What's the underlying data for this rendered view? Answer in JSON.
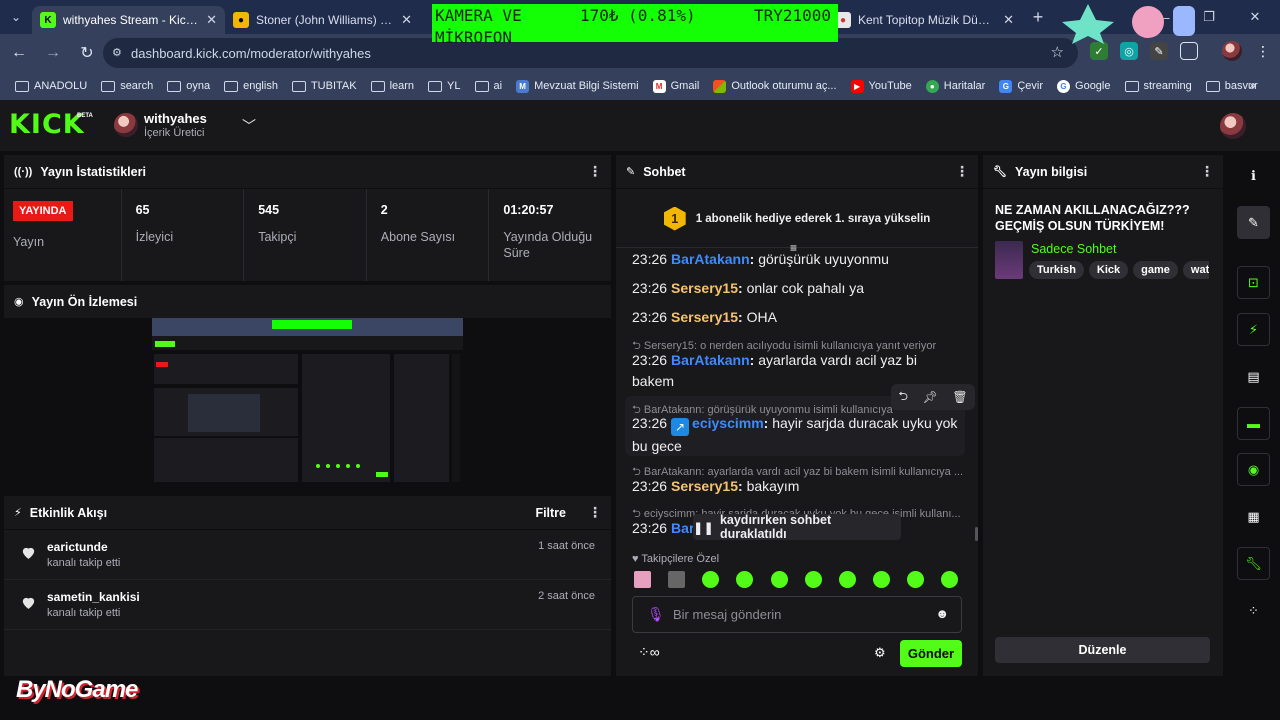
{
  "browser": {
    "tabs": [
      {
        "title": "withyahes Stream - Kick Dashboard",
        "favicon": "kick-icon"
      },
      {
        "title": "Stoner (John Williams) Fiyatı, Yorumları",
        "favicon": "coin-icon"
      },
      {
        "title": "Kent Topitop Müzik Düdüklü Maşa",
        "favicon": "site-icon"
      }
    ],
    "url": "dashboard.kick.com/moderator/withyahes",
    "bookmarks": [
      "ANADOLU",
      "search",
      "oyna",
      "english",
      "TUBITAK",
      "learn",
      "YL",
      "ai",
      "Mevzuat Bilgi Sistemi",
      "Gmail",
      "Outlook oturumu aç...",
      "YouTube",
      "Haritalar",
      "Çevir",
      "Google",
      "streaming",
      "basvur"
    ]
  },
  "overlay": {
    "line1": "KAMERA VE",
    "line2": "MİKROFON",
    "price": "170₺ (0.81%)",
    "total": "TRY21000"
  },
  "kick": {
    "logo": "KICK",
    "beta": "BETA",
    "channel_name": "withyahes",
    "channel_role": "İçerik Üretici"
  },
  "stats": {
    "title": "Yayın İstatistikleri",
    "live_badge": "YAYINDA",
    "live_label": "Yayın",
    "viewers_value": "65",
    "viewers_label": "İzleyici",
    "followers_value": "545",
    "followers_label": "Takipçi",
    "subs_value": "2",
    "subs_label": "Abone Sayısı",
    "uptime_value": "01:20:57",
    "uptime_label": "Yayında Olduğu Süre"
  },
  "preview": {
    "title": "Yayın Ön İzlemesi"
  },
  "activity": {
    "title": "Etkinlik Akışı",
    "filter": "Filtre",
    "items": [
      {
        "name": "earictunde",
        "action": "kanalı takip etti",
        "time": "1 saat önce"
      },
      {
        "name": "sametin_kankisi",
        "action": "kanalı takip etti",
        "time": "2 saat önce"
      }
    ]
  },
  "chat": {
    "title": "Sohbet",
    "sub_goal_rank": "1",
    "sub_goal_text": "1 abonelik hediye ederek 1. sıraya yükselin",
    "messages": [
      {
        "time": "23:26",
        "user": "BarAtakann",
        "text": "görüşürük uyuyonmu",
        "color": "#3d8bfd"
      },
      {
        "time": "23:26",
        "user": "Sersery15",
        "text": "onlar cok pahalı ya",
        "color": "#f5c36b"
      },
      {
        "time": "23:26",
        "user": "Sersery15",
        "text": "OHA",
        "color": "#f5c36b"
      },
      {
        "time": "23:26",
        "user": "BarAtakann",
        "text": "ayarlarda vardı acil yaz bi bakem",
        "color": "#3d8bfd",
        "reply_to": "Sersery15: o nerden acılıyodu isimli kullanıcıya yanıt veriyor"
      },
      {
        "time": "23:26",
        "user": "eciyscimm",
        "text": "hayir sarjda duracak uyku yok bu gece",
        "color": "#3d8bfd",
        "reply_to": "BarAtakann: görüşürük uyuyonmu isimli kullanıcıya yanıt veriyor"
      },
      {
        "time": "23:26",
        "user": "Sersery15",
        "text": "bakayım",
        "color": "#f5c36b",
        "reply_to": "BarAtakann: ayarlarda vardı acil yaz bi bakem isimli kullanıcıya ..."
      },
      {
        "time": "23:26",
        "user": "Bar",
        "text": "",
        "color": "#3d8bfd",
        "reply_to": "eciyscimm: hayir sarjda duracak uyku yok bu gece isimli kullanı..."
      }
    ],
    "paused_text": "kaydırırken sohbet duraklatıldı",
    "follower_only": "Takipçilere Özel",
    "input_placeholder": "Bir mesaj gönderin",
    "send_label": "Gönder"
  },
  "stream_info": {
    "title": "Yayın bilgisi",
    "stream_title": "NE ZAMAN AKILLANACAĞIZ??? GEÇMİŞ OLSUN TÜRKİYEM!",
    "category": "Sadece Sohbet",
    "tags": [
      "Turkish",
      "Kick",
      "game",
      "watch"
    ],
    "edit_label": "Düzenle"
  },
  "watermark": "ByNoGame",
  "colors": {
    "kick_green": "#53fc18",
    "live_red": "#e91916",
    "panel_bg": "#18181b",
    "page_bg": "#0e0e10"
  }
}
